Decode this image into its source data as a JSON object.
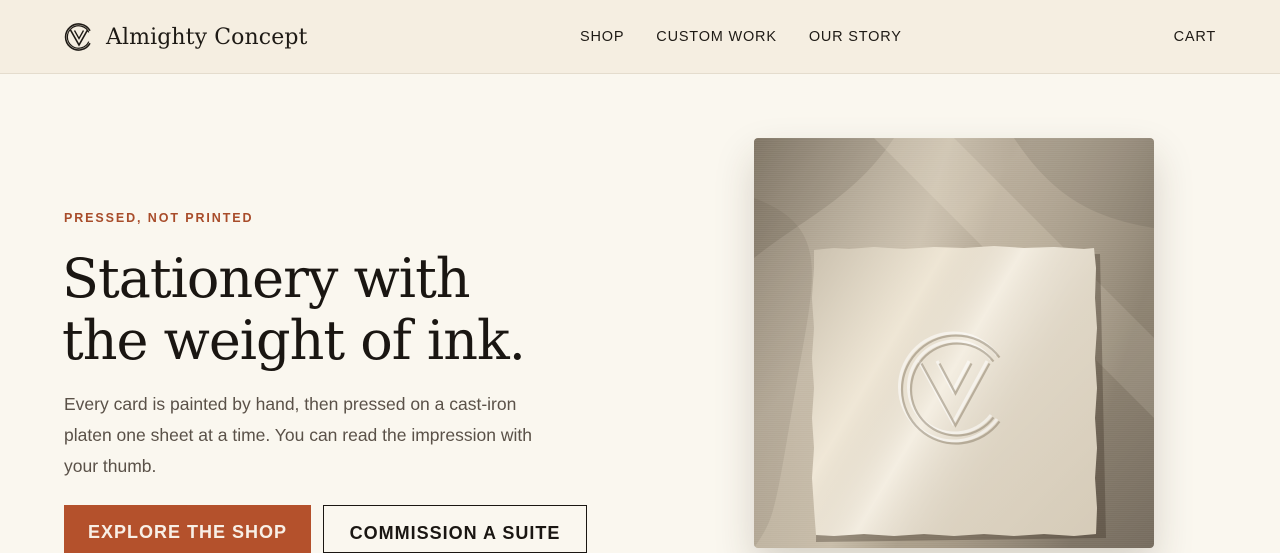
{
  "header": {
    "brand_name": "Almighty Concept",
    "logo_icon": "almighty-v-monogram-icon",
    "nav": [
      {
        "label": "SHOP"
      },
      {
        "label": "CUSTOM WORK"
      },
      {
        "label": "OUR STORY"
      }
    ],
    "cart_label": "CART"
  },
  "hero": {
    "eyebrow": "PRESSED, NOT PRINTED",
    "headline_line1": "Stationery with",
    "headline_line2": "the weight of ink.",
    "lede": "Every card is painted by hand, then pressed on a cast-iron platen one sheet at a time. You can read the impression with your thumb.",
    "primary_cta": "EXPLORE THE SHOP",
    "secondary_cta": "COMMISSION A SUITE",
    "image": "letterpress-card-on-linen-photo"
  },
  "colors": {
    "header_bg": "#f5eee1",
    "page_bg": "#faf7ef",
    "accent": "#b4512c",
    "eyebrow": "#a84c2a",
    "text": "#1a1612"
  }
}
